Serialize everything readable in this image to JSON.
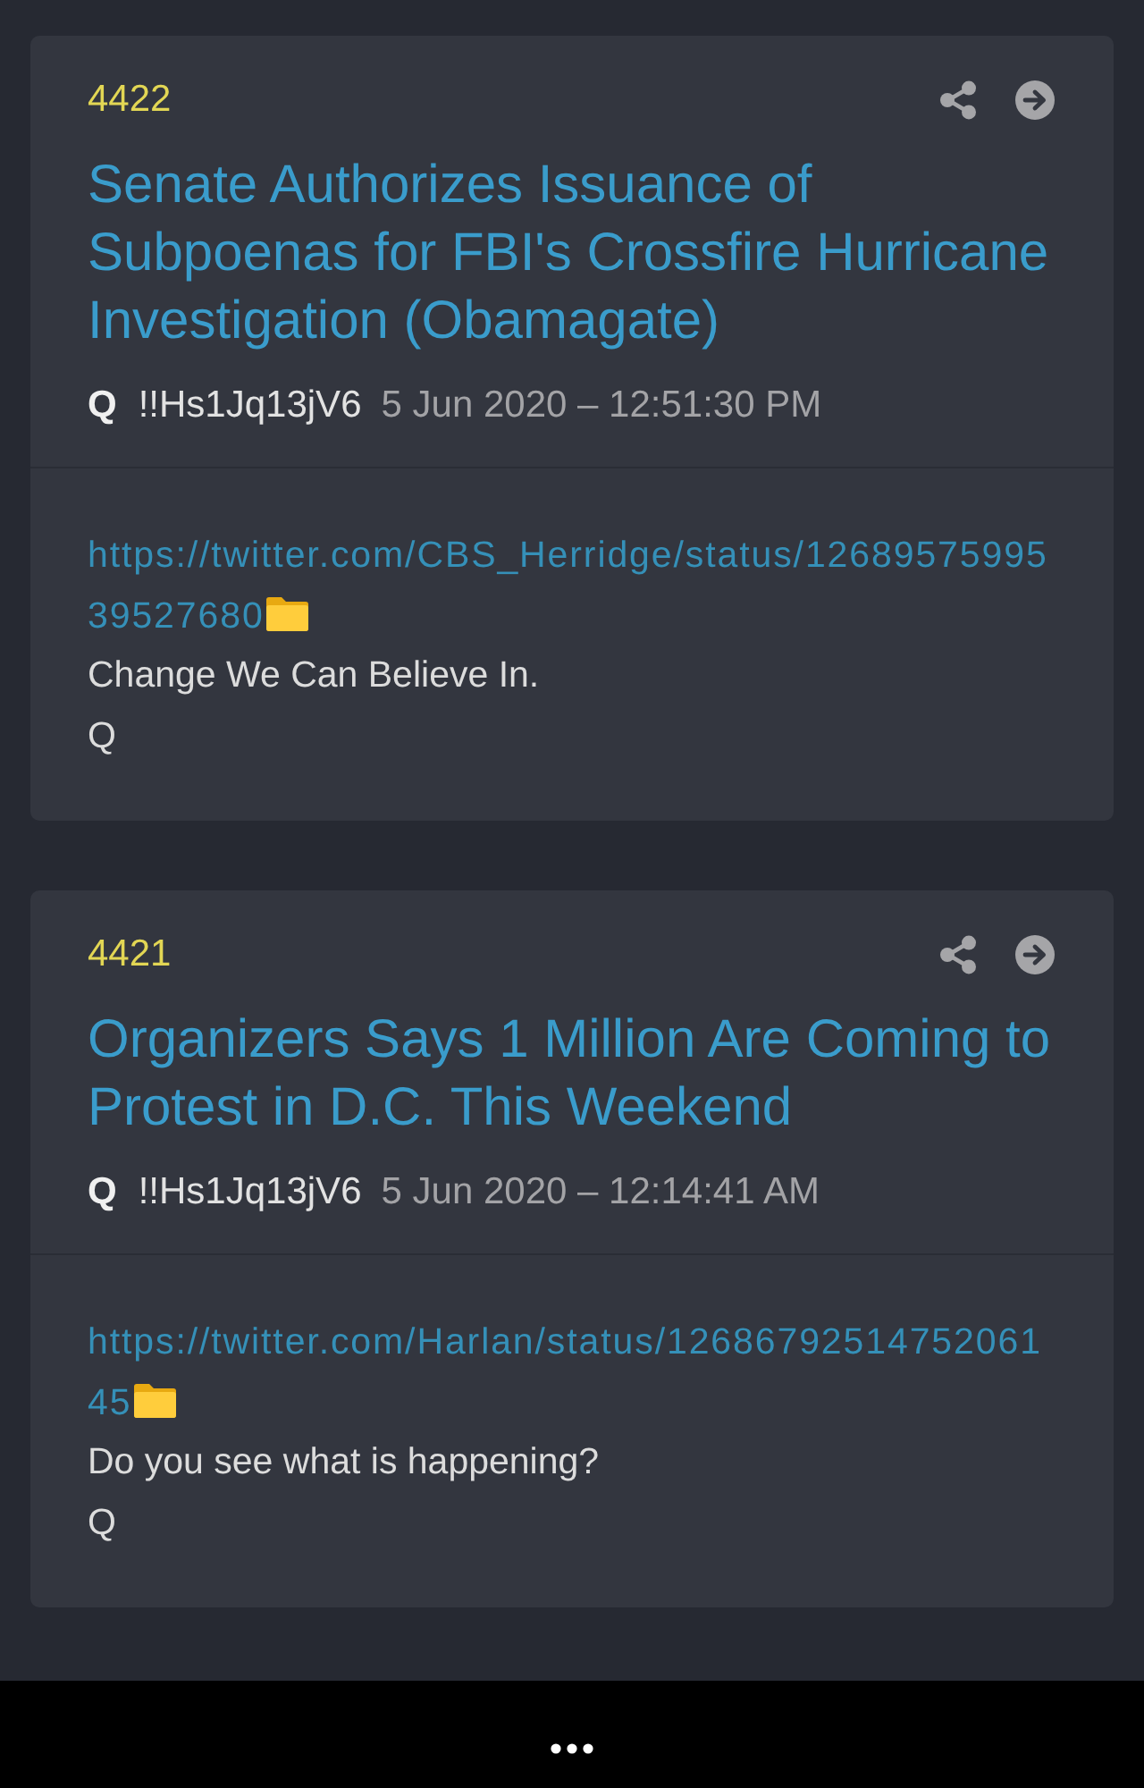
{
  "posts": [
    {
      "number": "4422",
      "title": "Senate Authorizes Issuance of Subpoenas for FBI's Crossfire Hurricane Investigation (Obamagate)",
      "author": "Q",
      "tripcode": "!!Hs1Jq13jV6",
      "timestamp": "5 Jun 2020 – 12:51:30 PM",
      "link": "https://twitter.com/CBS_Herridge/status/1268957599539527680",
      "body": [
        "Change We Can Believe In.",
        "Q"
      ]
    },
    {
      "number": "4421",
      "title": "Organizers Says 1 Million Are Coming to Protest in D.C. This Weekend",
      "author": "Q",
      "tripcode": "!!Hs1Jq13jV6",
      "timestamp": "5 Jun 2020 – 12:14:41 AM",
      "link": "https://twitter.com/Harlan/status/1268679251475206145",
      "body": [
        "Do you see what is happening?",
        "Q"
      ]
    }
  ]
}
